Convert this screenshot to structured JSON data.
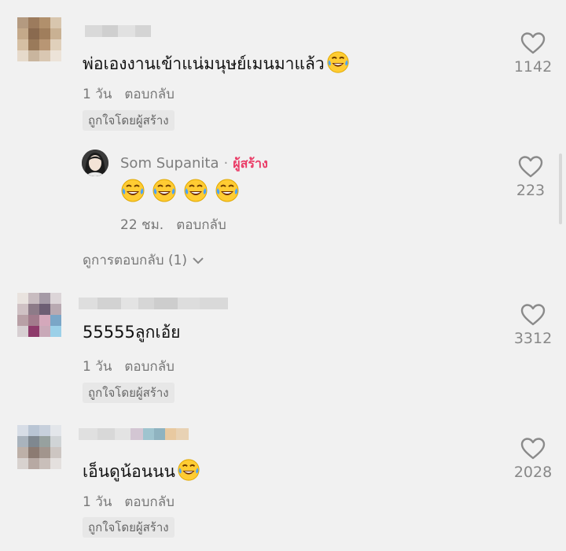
{
  "reply_label": "ตอบกลับ",
  "creator_liked_label": "ถูกใจโดยผู้สร้าง",
  "creator_badge": "ผู้สร้าง",
  "icons": {
    "like": "heart-outline-icon",
    "emoji": "face-with-tears-of-joy-emoji",
    "expand": "chevron-down-icon"
  },
  "colors": {
    "background": "#f1f1f1",
    "creator_badge": "#ea3b66",
    "muted_text": "#777777"
  },
  "comments": [
    {
      "text": "พ่อเองงานเข้าแน่มนุษย์เมนมาแล้ว",
      "time": "1 วัน",
      "likes": "1142",
      "emoji_count": 1,
      "username_blurred": true
    },
    {
      "text": "55555ลูกเอ้ย",
      "time": "1 วัน",
      "likes": "3312",
      "emoji_count": 0,
      "username_blurred": true
    },
    {
      "text": "เอ็นดูน้อนนน",
      "time": "1 วัน",
      "likes": "2028",
      "emoji_count": 1,
      "username_blurred": true
    }
  ],
  "reply": {
    "author": "Som Supanita",
    "separator": "·",
    "emoji_count": 4,
    "time": "22 ชม.",
    "likes": "223"
  },
  "view_replies": "ดูการตอบกลับ (1)"
}
